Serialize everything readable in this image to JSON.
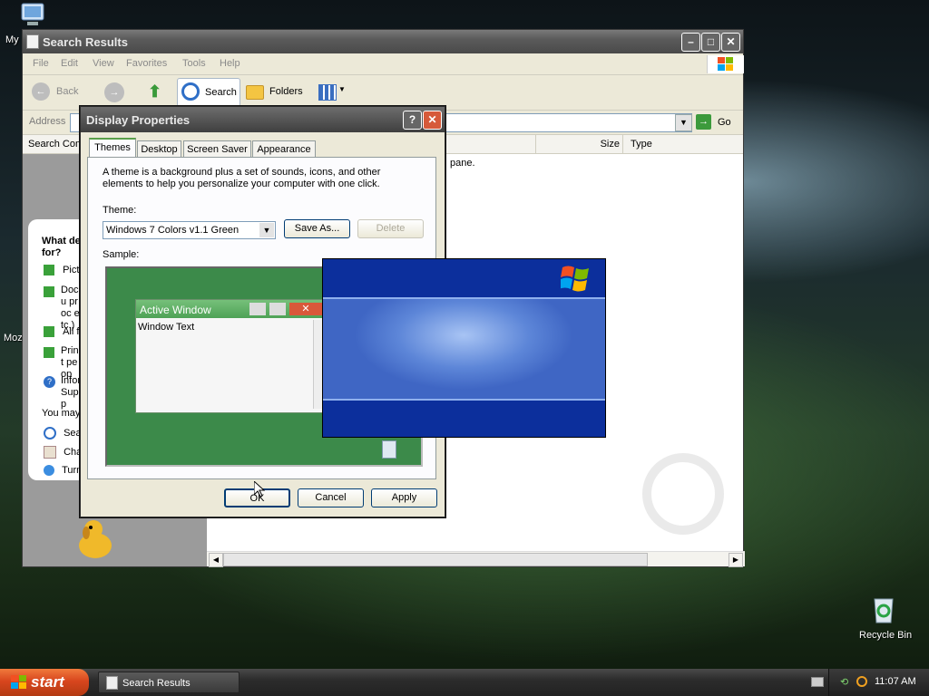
{
  "desktop": {
    "icons": [
      {
        "label": "My"
      },
      {
        "label": "Moz"
      },
      {
        "label": "Recycle Bin"
      }
    ]
  },
  "explorer": {
    "title": "Search Results",
    "menu": [
      "File",
      "Edit",
      "View",
      "Favorites",
      "Tools",
      "Help"
    ],
    "toolbar": {
      "back": "Back",
      "search": "Search",
      "folders": "Folders"
    },
    "address": {
      "label": "Address",
      "go": "Go"
    },
    "columns": {
      "size": "Size",
      "type": "Type",
      "search_companion": "Search Com"
    },
    "results_text": "pane.",
    "companion": {
      "question": "What do you want to search for?",
      "question_visible": [
        "What de",
        "for?"
      ],
      "options": [
        "Pictu",
        "Docu proc etc.)",
        "All fil",
        "Print peop",
        "Infor Supp"
      ],
      "you_may": "You may",
      "extras": [
        "Sear",
        "Char",
        "Turn"
      ]
    }
  },
  "dialog": {
    "title": "Display Properties",
    "tabs": [
      "Themes",
      "Desktop",
      "Screen Saver",
      "Appearance"
    ],
    "description": "A theme is a background plus a set of sounds, icons, and other elements to help you personalize your computer with one click.",
    "theme_label": "Theme:",
    "theme_value": "Windows 7 Colors v1.1 Green",
    "save_as": "Save As...",
    "delete": "Delete",
    "sample_label": "Sample:",
    "sample_window_title": "Active Window",
    "sample_window_text": "Window Text",
    "ok": "OK",
    "cancel": "Cancel",
    "apply": "Apply"
  },
  "taskbar": {
    "start": "start",
    "task": "Search Results",
    "clock": "11:07 AM"
  },
  "colors": {
    "dialog_face": "#ece9d8",
    "sample_green": "#3c8a4a",
    "splash_blue": "#0c2f9c",
    "start_orange": "#d8461e"
  }
}
